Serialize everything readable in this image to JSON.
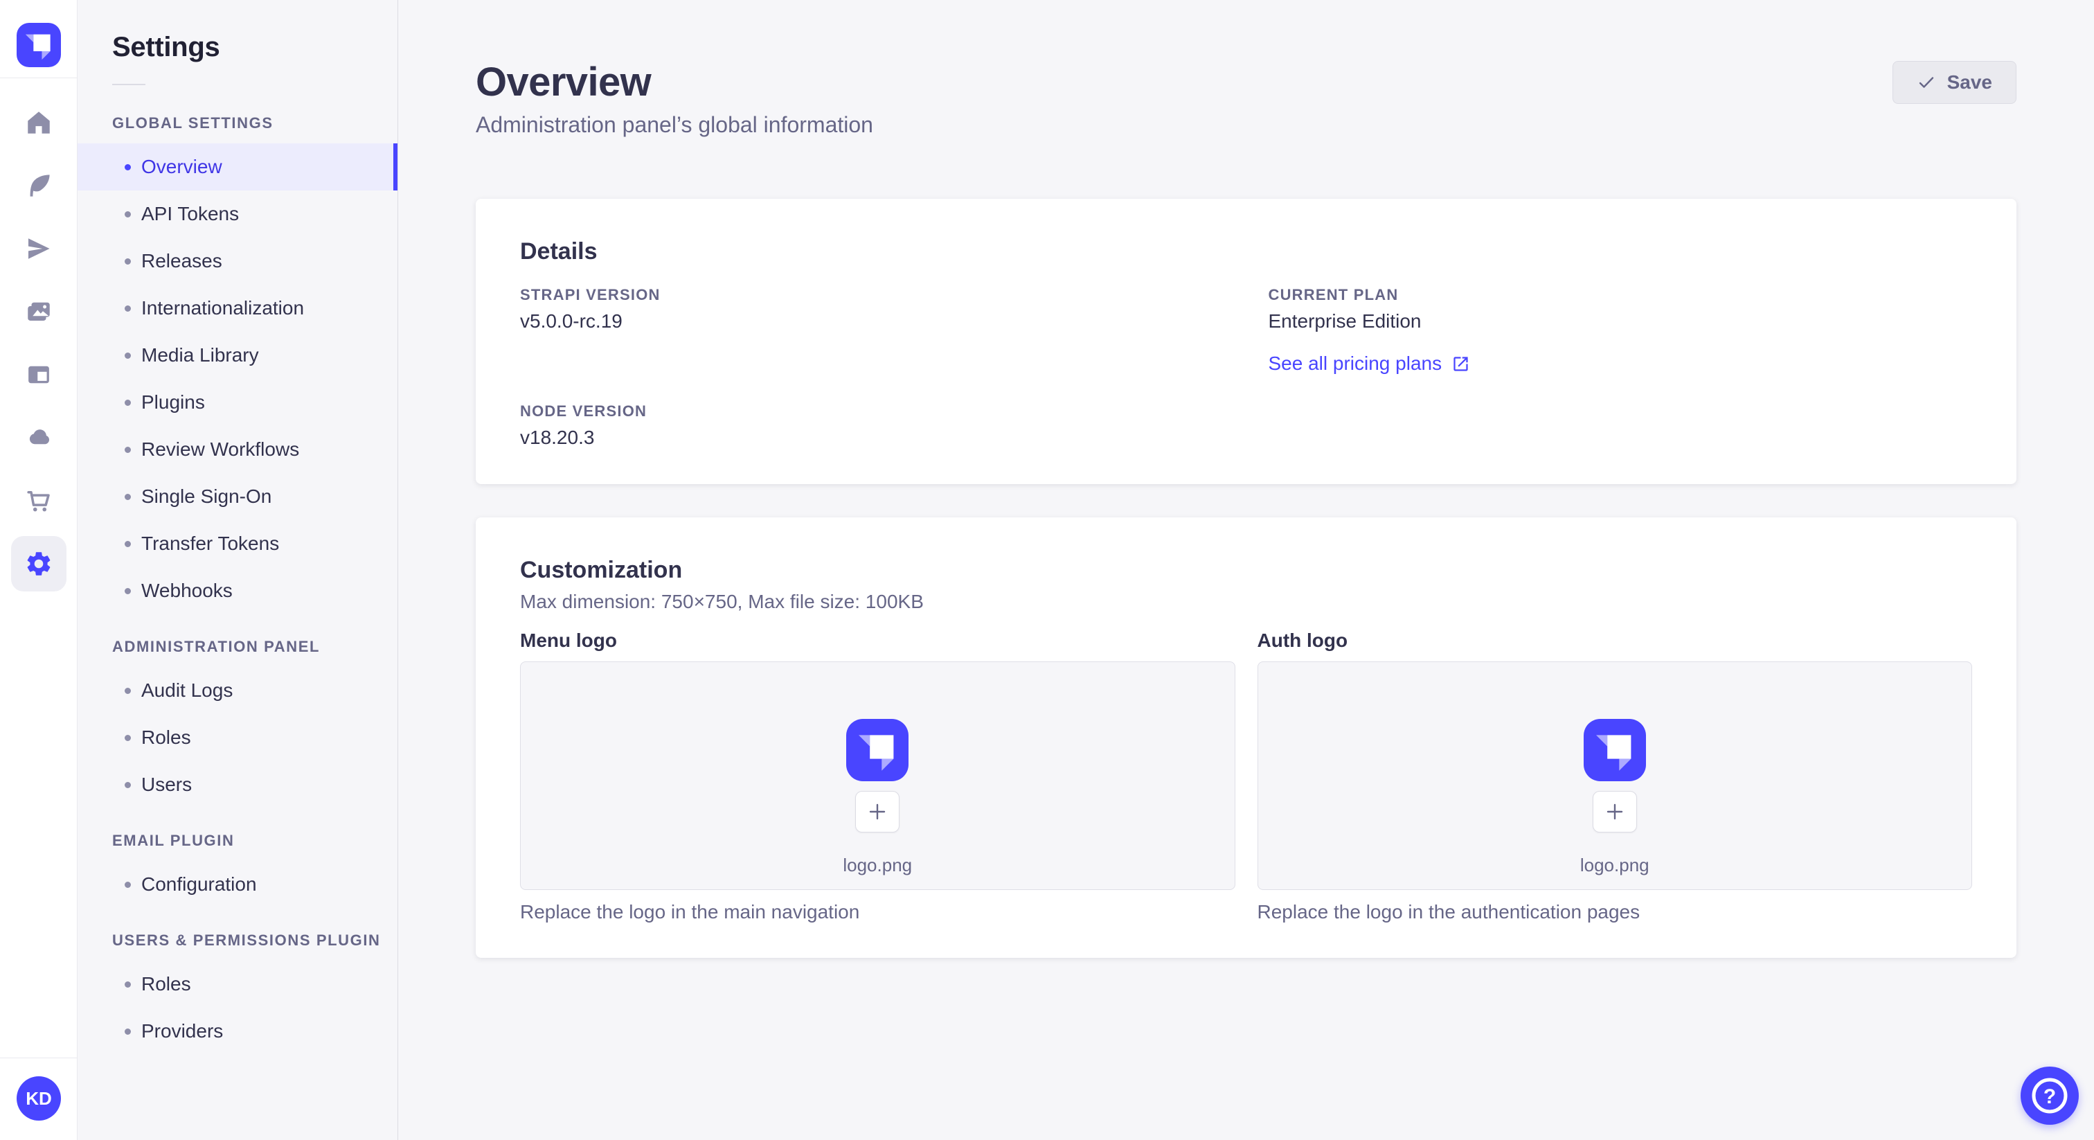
{
  "colors": {
    "primary": "#4945ff",
    "active_text": "#3f35e6",
    "text_dark": "#32324d",
    "text_muted": "#666687",
    "page_bg": "#f6f6f9",
    "card_bg": "#ffffff"
  },
  "rail": {
    "icons": [
      "strapi-logo",
      "home",
      "feather",
      "paper-plane",
      "media-gallery",
      "layout",
      "cloud",
      "cart",
      "gear"
    ],
    "active_icon": "gear"
  },
  "user": {
    "initials": "KD"
  },
  "sidebar": {
    "title": "Settings",
    "sections": [
      {
        "label": "GLOBAL SETTINGS",
        "items": [
          {
            "label": "Overview",
            "active": true
          },
          {
            "label": "API Tokens"
          },
          {
            "label": "Releases"
          },
          {
            "label": "Internationalization"
          },
          {
            "label": "Media Library"
          },
          {
            "label": "Plugins"
          },
          {
            "label": "Review Workflows"
          },
          {
            "label": "Single Sign-On"
          },
          {
            "label": "Transfer Tokens"
          },
          {
            "label": "Webhooks"
          }
        ]
      },
      {
        "label": "ADMINISTRATION PANEL",
        "items": [
          {
            "label": "Audit Logs"
          },
          {
            "label": "Roles"
          },
          {
            "label": "Users"
          }
        ]
      },
      {
        "label": "EMAIL PLUGIN",
        "items": [
          {
            "label": "Configuration"
          }
        ]
      },
      {
        "label": "USERS & PERMISSIONS PLUGIN",
        "items": [
          {
            "label": "Roles"
          },
          {
            "label": "Providers"
          }
        ]
      }
    ]
  },
  "header": {
    "title": "Overview",
    "subtitle": "Administration panel’s global information",
    "save_label": "Save"
  },
  "details": {
    "title": "Details",
    "strapi_version_label": "STRAPI VERSION",
    "strapi_version": "v5.0.0-rc.19",
    "current_plan_label": "CURRENT PLAN",
    "current_plan": "Enterprise Edition",
    "pricing_link": "See all pricing plans",
    "node_version_label": "NODE VERSION",
    "node_version": "v18.20.3"
  },
  "customization": {
    "title": "Customization",
    "subtitle": "Max dimension: 750×750, Max file size: 100KB",
    "menu_logo": {
      "label": "Menu logo",
      "filename": "logo.png",
      "caption": "Replace the logo in the main navigation"
    },
    "auth_logo": {
      "label": "Auth logo",
      "filename": "logo.png",
      "caption": "Replace the logo in the authentication pages"
    }
  }
}
